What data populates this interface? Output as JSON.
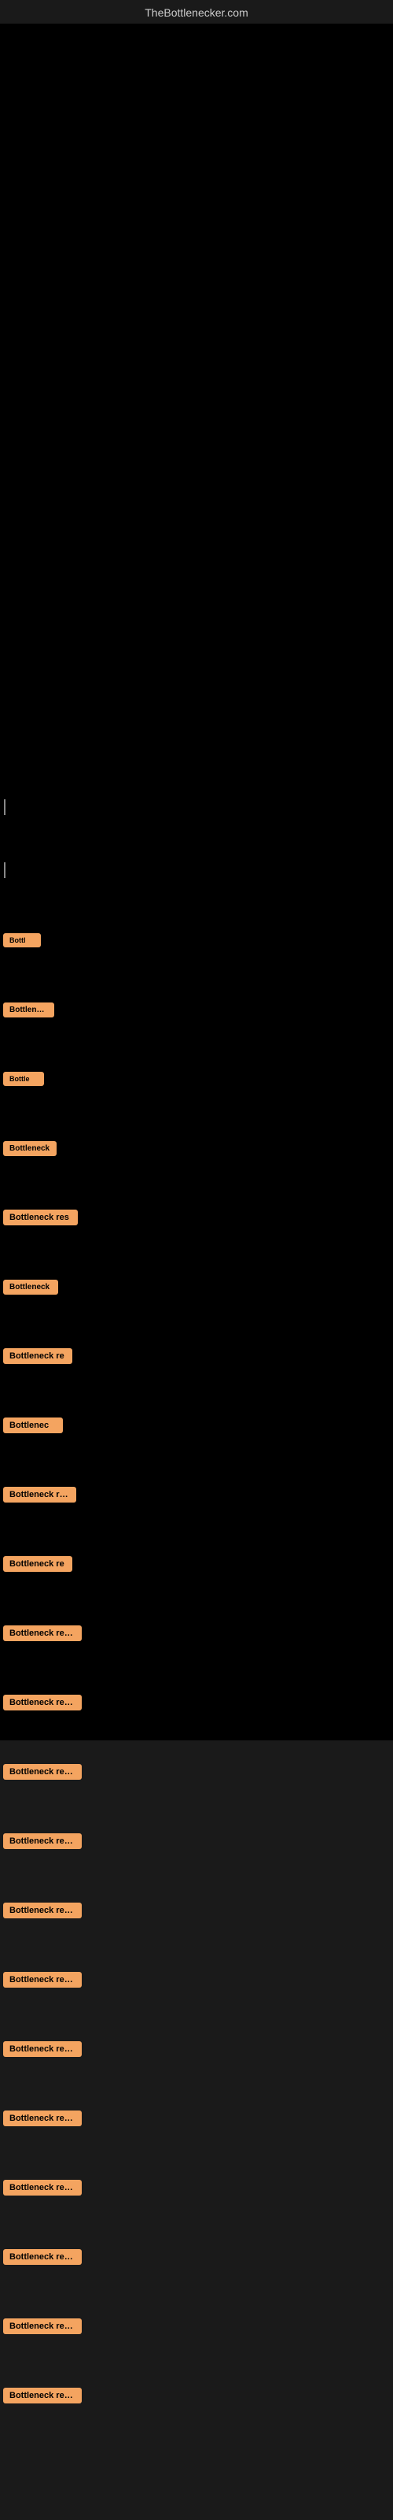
{
  "site": {
    "title": "TheBottlenecker.com"
  },
  "bottleneck_items": [
    {
      "id": 1,
      "label": "Bottl",
      "class": "item-1"
    },
    {
      "id": 2,
      "label": "Bottleneck",
      "class": "item-2"
    },
    {
      "id": 3,
      "label": "Bottle",
      "class": "item-3"
    },
    {
      "id": 4,
      "label": "Bottleneck",
      "class": "item-4"
    },
    {
      "id": 5,
      "label": "Bottleneck res",
      "class": "item-5"
    },
    {
      "id": 6,
      "label": "Bottleneck",
      "class": "item-6"
    },
    {
      "id": 7,
      "label": "Bottleneck re",
      "class": "item-7"
    },
    {
      "id": 8,
      "label": "Bottlenec",
      "class": "item-8"
    },
    {
      "id": 9,
      "label": "Bottleneck resu",
      "class": "item-9"
    },
    {
      "id": 10,
      "label": "Bottleneck re",
      "class": "item-10"
    },
    {
      "id": 11,
      "label": "Bottleneck result",
      "class": "item-11"
    },
    {
      "id": 12,
      "label": "Bottleneck result",
      "class": "item-12"
    },
    {
      "id": 13,
      "label": "Bottleneck result",
      "class": "item-13"
    },
    {
      "id": 14,
      "label": "Bottleneck result",
      "class": "item-14"
    },
    {
      "id": 15,
      "label": "Bottleneck result",
      "class": "item-15"
    },
    {
      "id": 16,
      "label": "Bottleneck result",
      "class": "item-16"
    },
    {
      "id": 17,
      "label": "Bottleneck result",
      "class": "item-17"
    },
    {
      "id": 18,
      "label": "Bottleneck result",
      "class": "item-18"
    },
    {
      "id": 19,
      "label": "Bottleneck result",
      "class": "item-19"
    },
    {
      "id": 20,
      "label": "Bottleneck result",
      "class": "item-20"
    },
    {
      "id": 21,
      "label": "Bottleneck result",
      "class": "item-21"
    },
    {
      "id": 22,
      "label": "Bottleneck result",
      "class": "item-22"
    }
  ]
}
